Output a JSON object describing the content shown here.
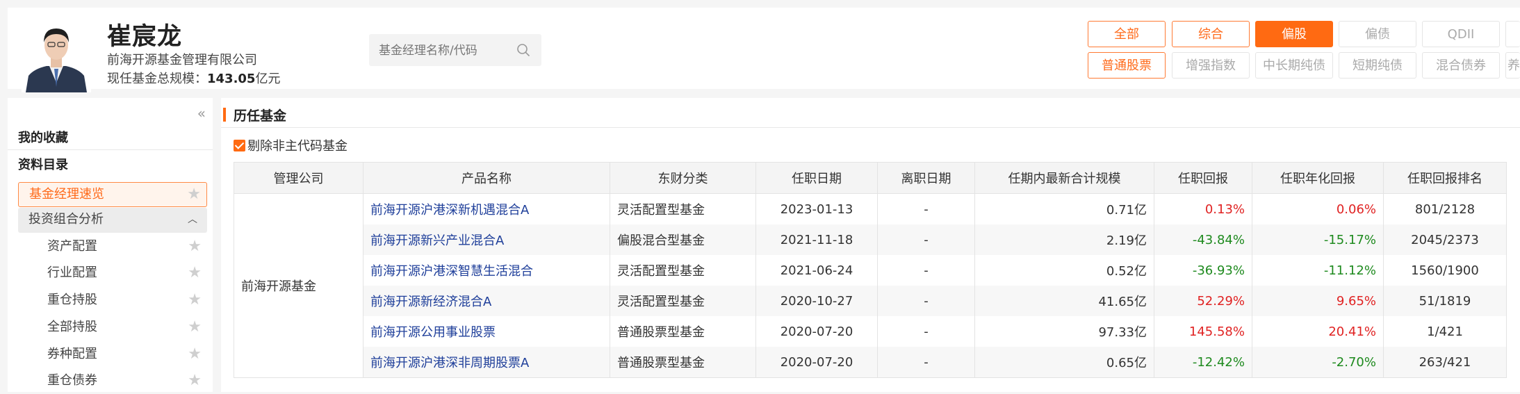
{
  "manager": {
    "name": "崔宸龙",
    "company": "前海开源基金管理有限公司",
    "scale_label": "现任基金总规模：",
    "scale_value": "143.05",
    "scale_unit": "亿元"
  },
  "search": {
    "placeholder": "基金经理名称/代码"
  },
  "filters": {
    "row1": [
      "全部",
      "综合",
      "偏股",
      "偏债",
      "QDII",
      ""
    ],
    "row2": [
      "普通股票",
      "增强指数",
      "中长期纯债",
      "短期纯债",
      "混合债券",
      "养"
    ]
  },
  "sidebar": {
    "favorites": "我的收藏",
    "catalog": "资料目录",
    "items": [
      {
        "label": "基金经理速览"
      },
      {
        "label": "投资组合分析"
      },
      {
        "label": "资产配置"
      },
      {
        "label": "行业配置"
      },
      {
        "label": "重仓持股"
      },
      {
        "label": "全部持股"
      },
      {
        "label": "券种配置"
      },
      {
        "label": "重仓债券"
      }
    ]
  },
  "section": {
    "title": "历任基金",
    "exclude_label": "剔除非主代码基金"
  },
  "table": {
    "headers": [
      "管理公司",
      "产品名称",
      "东财分类",
      "任职日期",
      "离职日期",
      "任期内最新合计规模",
      "任职回报",
      "任职年化回报",
      "任职回报排名"
    ],
    "company": "前海开源基金",
    "rows": [
      {
        "name": "前海开源沪港深新机遇混合A",
        "category": "灵活配置型基金",
        "start": "2023-01-13",
        "end": "-",
        "scale": "0.71亿",
        "ret": "0.13%",
        "annual": "0.06%",
        "rank": "801/2128"
      },
      {
        "name": "前海开源新兴产业混合A",
        "category": "偏股混合型基金",
        "start": "2021-11-18",
        "end": "-",
        "scale": "2.19亿",
        "ret": "-43.84%",
        "annual": "-15.17%",
        "rank": "2045/2373"
      },
      {
        "name": "前海开源沪港深智慧生活混合",
        "category": "灵活配置型基金",
        "start": "2021-06-24",
        "end": "-",
        "scale": "0.52亿",
        "ret": "-36.93%",
        "annual": "-11.12%",
        "rank": "1560/1900"
      },
      {
        "name": "前海开源新经济混合A",
        "category": "灵活配置型基金",
        "start": "2020-10-27",
        "end": "-",
        "scale": "41.65亿",
        "ret": "52.29%",
        "annual": "9.65%",
        "rank": "51/1819"
      },
      {
        "name": "前海开源公用事业股票",
        "category": "普通股票型基金",
        "start": "2020-07-20",
        "end": "-",
        "scale": "97.33亿",
        "ret": "145.58%",
        "annual": "20.41%",
        "rank": "1/421"
      },
      {
        "name": "前海开源沪港深非周期股票A",
        "category": "普通股票型基金",
        "start": "2020-07-20",
        "end": "-",
        "scale": "0.65亿",
        "ret": "-12.42%",
        "annual": "-2.70%",
        "rank": "263/421"
      }
    ]
  },
  "colors": {
    "accent": "#ff6a12",
    "positive": "#e02222",
    "negative": "#1e8a1e",
    "link": "#1f3f9a"
  }
}
